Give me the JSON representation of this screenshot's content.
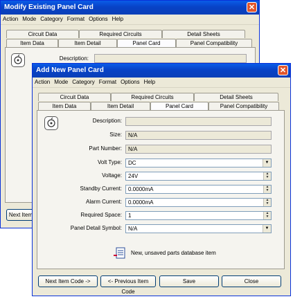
{
  "back": {
    "title": "Modify Existing Panel Card",
    "menu": [
      "Action",
      "Mode",
      "Category",
      "Format",
      "Options",
      "Help"
    ],
    "tabs_top": [
      "Circuit Data",
      "Required Circuits",
      "Detail Sheets"
    ],
    "tabs_bottom": [
      "Item Data",
      "Item Detail",
      "Panel Card",
      "Panel Compatibility"
    ],
    "description_label": "Description:",
    "next_button": "Next Item"
  },
  "front": {
    "title": "Add New Panel Card",
    "menu": [
      "Action",
      "Mode",
      "Category",
      "Format",
      "Options",
      "Help"
    ],
    "tabs_top": [
      "Circuit Data",
      "Required Circuits",
      "Detail Sheets"
    ],
    "tabs_bottom": [
      "Item Data",
      "Item Detail",
      "Panel Card",
      "Panel Compatibility"
    ],
    "fields": {
      "description": {
        "label": "Description:",
        "value": ""
      },
      "size": {
        "label": "Size:",
        "value": "N/A"
      },
      "part_number": {
        "label": "Part Number:",
        "value": "N/A"
      },
      "volt_type": {
        "label": "Volt Type:",
        "value": "DC"
      },
      "voltage": {
        "label": "Voltage:",
        "value": "24V"
      },
      "standby_current": {
        "label": "Standby Current:",
        "value": "0.0000mA"
      },
      "alarm_current": {
        "label": "Alarm Current:",
        "value": "0.0000mA"
      },
      "required_space": {
        "label": "Required Space:",
        "value": "1"
      },
      "panel_detail_symbol": {
        "label": "Panel Detail Symbol:",
        "value": "N/A"
      }
    },
    "status_text": "New, unsaved parts database item",
    "buttons": {
      "next": "Next Item Code ->",
      "prev": "<- Previous Item Code",
      "save": "Save",
      "close": "Close"
    }
  }
}
